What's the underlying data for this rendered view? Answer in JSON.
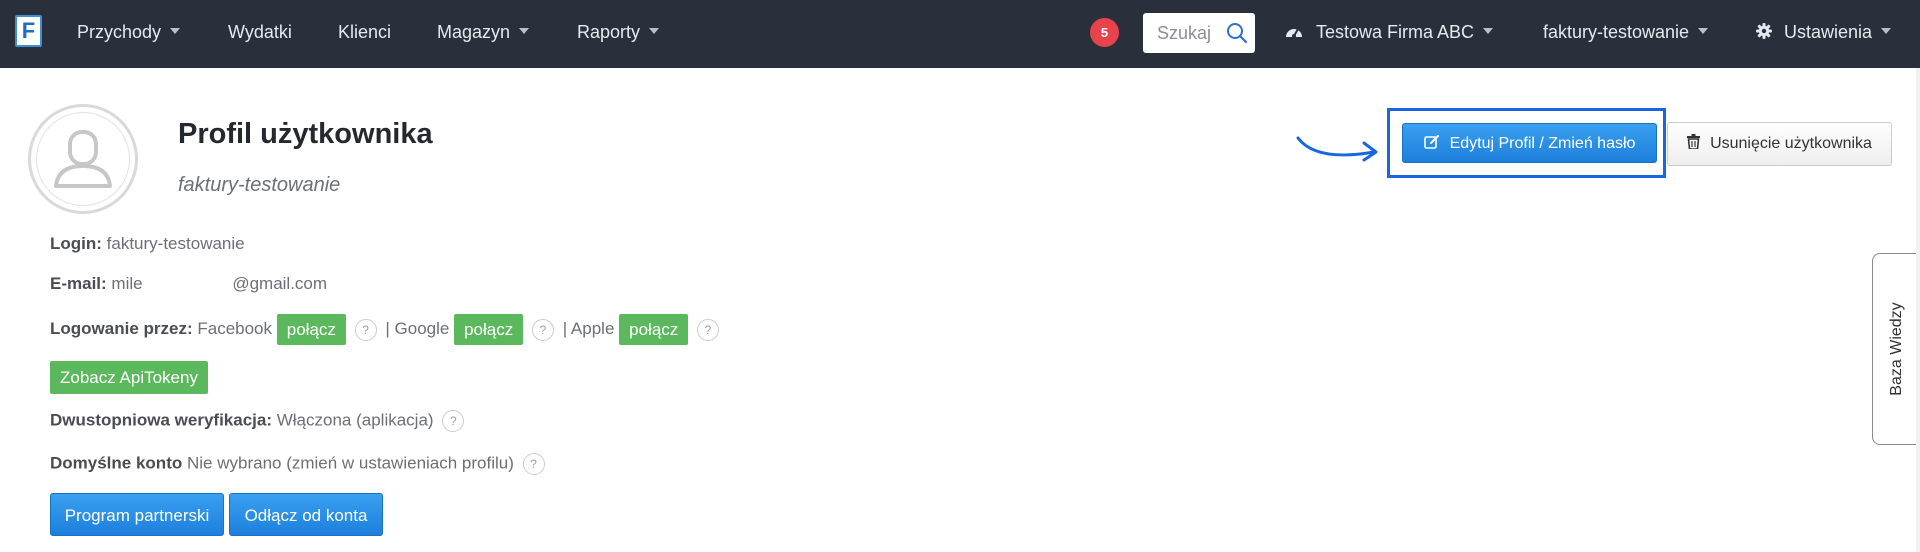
{
  "navbar": {
    "logo": "F",
    "menu": [
      {
        "label": "Przychody",
        "dropdown": true
      },
      {
        "label": "Wydatki",
        "dropdown": false
      },
      {
        "label": "Klienci",
        "dropdown": false
      },
      {
        "label": "Magazyn",
        "dropdown": true
      },
      {
        "label": "Raporty",
        "dropdown": true
      }
    ],
    "notifications_count": "5",
    "search_placeholder": "Szukaj",
    "company": "Testowa Firma ABC",
    "account": "faktury-testowanie",
    "settings": "Ustawienia"
  },
  "profile": {
    "title": "Profil użytkownika",
    "username": "faktury-testowanie",
    "login_label": "Login:",
    "login_value": "faktury-testowanie",
    "email_label": "E-mail:",
    "email_value": "mile                   @gmail.com",
    "social_label": "Logowanie przez:",
    "social": [
      {
        "provider": "Facebook",
        "action": "połącz"
      },
      {
        "provider": "Google",
        "action": "połącz"
      },
      {
        "provider": "Apple",
        "action": "połącz"
      }
    ],
    "separator": "|",
    "help_symbol": "?",
    "api_tokens_button": "Zobacz ApiTokeny",
    "twofa_label": "Dwustopniowa weryfikacja:",
    "twofa_value": "Włączona (aplikacja)",
    "default_account_label": "Domyślne konto",
    "default_account_value": "Nie wybrano (zmień w ustawieniach profilu)",
    "partner_button": "Program partnerski",
    "disconnect_button": "Odłącz od konta"
  },
  "actions": {
    "edit_button": "Edytuj Profil / Zmień hasło",
    "delete_button": "Usunięcie użytkownika"
  },
  "side_tab": "Baza Wiedzy",
  "colors": {
    "navbar_bg": "#2a303b",
    "primary_blue": "#1d7fdc",
    "green": "#5cb85c",
    "badge_red": "#e8434c",
    "highlight_frame": "#1a66e0"
  }
}
